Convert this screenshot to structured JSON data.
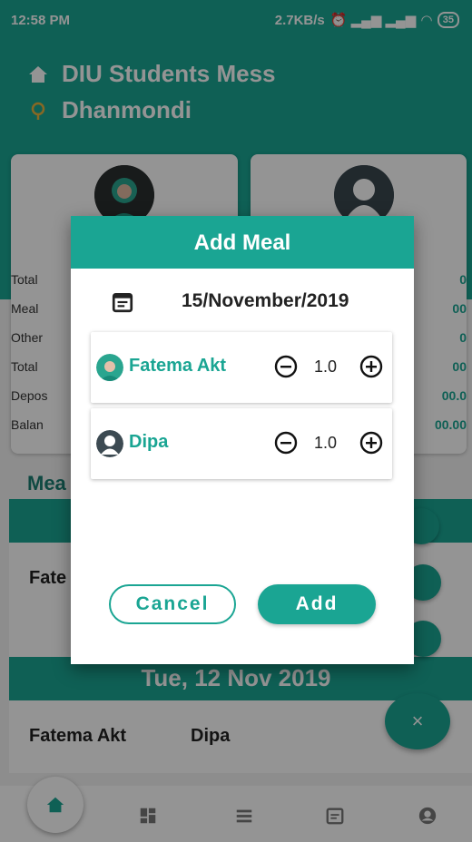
{
  "status_bar": {
    "time": "12:58 PM",
    "speed": "2.7KB/s",
    "battery": "35"
  },
  "header": {
    "title": "DIU Students Mess",
    "subtitle": "Dhanmondi"
  },
  "summary_left": {
    "lines": [
      "Total",
      "Meal",
      "Other",
      "Total",
      "Depos",
      "Balan"
    ]
  },
  "summary_right": {
    "lines": [
      "0",
      "00",
      "0",
      "00",
      "00.0",
      "00.00"
    ]
  },
  "meal_section": {
    "heading": "Mea",
    "row1_name": "Fate",
    "date2": "Tue, 12 Nov 2019",
    "row2_name1": "Fatema Akt",
    "row2_name2": "Dipa"
  },
  "fab": {
    "label": "×"
  },
  "dialog": {
    "title": "Add Meal",
    "date": "15/November/2019",
    "members": [
      {
        "name": "Fatema Akt",
        "qty": "1.0"
      },
      {
        "name": "Dipa",
        "qty": "1.0"
      }
    ],
    "cancel_label": "Cancel",
    "add_label": "Add"
  },
  "colors": {
    "primary": "#1aa593",
    "scrim": "rgba(0,0,0,0.42)"
  },
  "icons": [
    "home-icon",
    "location-icon",
    "calendar-icon",
    "minus-circle-icon",
    "plus-circle-icon",
    "dashboard-icon",
    "list-icon",
    "calendar-nav-icon",
    "account-icon"
  ]
}
